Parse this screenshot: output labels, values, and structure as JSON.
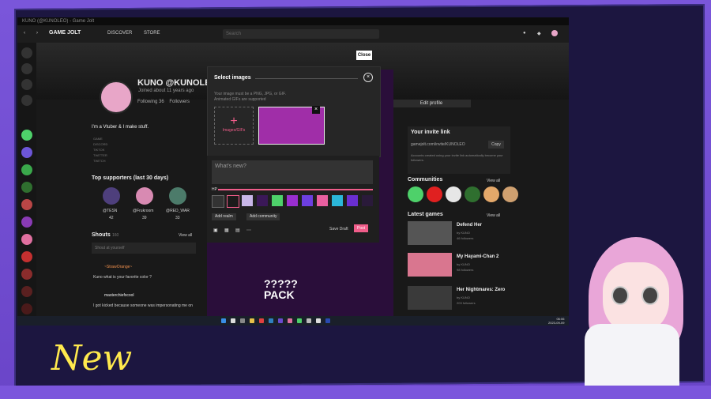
{
  "window": {
    "title": "KUNO (@KUNOLEO) - Game Jolt"
  },
  "nav": {
    "discover": "DISCOVER",
    "store": "STORE",
    "search_placeholder": "Search"
  },
  "profile": {
    "name": "KUNO @KUNOLEO",
    "joined": "Joined about 11 years ago",
    "tabs": [
      "Following 36",
      "Followers"
    ],
    "edit_label": "Edit profile",
    "bio": "I'm a Vtuber & I make stuff.",
    "links": [
      "GAME",
      "DISCORD",
      "TIKTOK",
      "TWITTER",
      "TWITCH"
    ]
  },
  "supporters": {
    "title": "Top supporters (last 30 days)",
    "items": [
      {
        "name": "@TESN",
        "count": "42"
      },
      {
        "name": "@Frukroom",
        "count": "39"
      },
      {
        "name": "@RED_WAR",
        "count": "33"
      }
    ]
  },
  "shouts": {
    "title": "Shouts",
    "count": "160",
    "view_all": "View all",
    "input_placeholder": "Shout at yourself",
    "posts": [
      {
        "author": "~StrawOrange~",
        "text": "Kuno what is your favorite color ?"
      },
      {
        "author": "masterchiefxcool",
        "text": "I got kicked because someone was impersonating me on"
      }
    ]
  },
  "invite": {
    "title": "Your invite link",
    "link": "gamejolt.com/invite/KUNOLEO",
    "copy": "Copy",
    "note": "Accounts created using your invite link automatically become your followers."
  },
  "communities": {
    "title": "Communities",
    "view_all": "View all"
  },
  "latest_games": {
    "title": "Latest games",
    "view_all": "View all",
    "items": [
      {
        "title": "Defend Her",
        "meta": "by KUNO",
        "followers": "46 followers"
      },
      {
        "title": "My Hayami-Chan 2",
        "meta": "by KUNO",
        "followers": "98 followers"
      },
      {
        "title": "Her Nightmares: Zero",
        "meta": "by KUNO",
        "followers": "203 followers"
      }
    ]
  },
  "modal": {
    "title": "Select images",
    "hint1": "Your image must be a PNG, JPG, or GIF.",
    "hint2": "Animated GIFs are supported",
    "upload_label": "Images/GIFs",
    "close_button": "Close"
  },
  "composer": {
    "placeholder": "What's new?",
    "hp_label": "HP",
    "add_realm": "Add realm",
    "add_community": "Add community",
    "save_draft": "Save Draft",
    "post": "Post"
  },
  "pack_text": "????? PACK",
  "taskbar": {
    "time": "06:06",
    "date": "2023-09-09"
  },
  "overlay_text": "New",
  "colors": {
    "accent": "#f05d8a",
    "frame": "#6f4ad0",
    "overlay_text": "#ffe94d"
  }
}
